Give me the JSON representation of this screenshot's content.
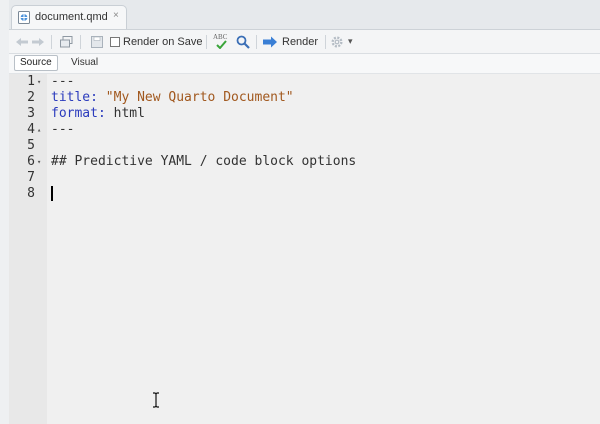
{
  "tab": {
    "filename": "document.qmd",
    "close": "×"
  },
  "toolbar": {
    "render_on_save": "Render on Save",
    "spellcheck_glyph": "ABC",
    "render": "Render",
    "caret": "▾"
  },
  "modebar": {
    "source": "Source",
    "visual": "Visual"
  },
  "editor": {
    "lines": [
      {
        "num": "1",
        "fold": "▾",
        "text": "---"
      },
      {
        "num": "2",
        "key": "title:",
        "value": " \"My New Quarto Document\""
      },
      {
        "num": "3",
        "key": "format:",
        "value": " html"
      },
      {
        "num": "4",
        "fold": "▴",
        "text": "---"
      },
      {
        "num": "5",
        "text": ""
      },
      {
        "num": "6",
        "fold": "▾",
        "text": "## Predictive YAML / code block options"
      },
      {
        "num": "7",
        "text": ""
      },
      {
        "num": "8",
        "text": ""
      }
    ]
  },
  "colors": {
    "yaml_key": "#2b3bbd",
    "yaml_string": "#a1581e",
    "render_arrow": "#3a7fd5"
  },
  "icons": [
    "quarto-doc-icon",
    "back-arrow-icon",
    "forward-arrow-icon",
    "open-in-window-icon",
    "save-icon",
    "spellcheck-icon",
    "search-icon",
    "render-arrow-icon",
    "gear-icon",
    "chevron-down-icon",
    "fold-arrow-icon",
    "ibeam-cursor-icon"
  ]
}
